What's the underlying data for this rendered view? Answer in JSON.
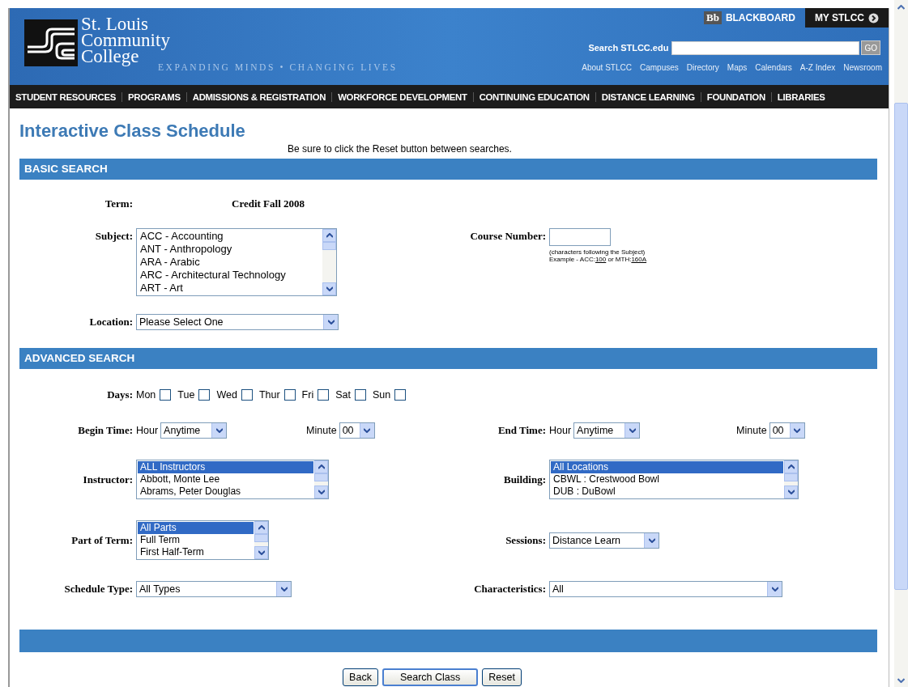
{
  "header": {
    "logo_lines": [
      "St. Louis",
      "Community",
      "College"
    ],
    "tagline": "EXPANDING MINDS • CHANGING LIVES",
    "top_links": [
      {
        "badge": "Bb",
        "label": "BLACKBOARD",
        "kind": "plain"
      },
      {
        "label": "MY STLCC",
        "kind": "dark"
      }
    ],
    "search": {
      "label": "Search STLCC.edu",
      "button": "GO"
    },
    "util_links": [
      "About STLCC",
      "Campuses",
      "Directory",
      "Maps",
      "Calendars",
      "A-Z Index",
      "Newsroom"
    ]
  },
  "nav": [
    "STUDENT RESOURCES",
    "PROGRAMS",
    "ADMISSIONS & REGISTRATION",
    "WORKFORCE DEVELOPMENT",
    "CONTINUING EDUCATION",
    "DISTANCE LEARNING",
    "FOUNDATION",
    "LIBRARIES"
  ],
  "page_title": "Interactive Class Schedule",
  "notice": "Be sure to click the Reset button between searches.",
  "basic": {
    "heading": "BASIC SEARCH",
    "term": {
      "label": "Term:",
      "value": "Credit Fall 2008"
    },
    "subject": {
      "label": "Subject:",
      "options": [
        {
          "text": "ACC - Accounting",
          "selected": false
        },
        {
          "text": "ANT - Anthropology",
          "selected": false
        },
        {
          "text": "ARA - Arabic",
          "selected": false
        },
        {
          "text": "ARC - Architectural Technology",
          "selected": false
        },
        {
          "text": "ART - Art",
          "selected": false
        }
      ]
    },
    "course_number": {
      "label": "Course Number:",
      "hint": "(characters following the Subject)",
      "example": "Example - ACC:",
      "ex1": "100",
      "mid": " or MTH:",
      "ex2": "160A"
    },
    "location": {
      "label": "Location:",
      "value": "Please Select One"
    }
  },
  "advanced": {
    "heading": "ADVANCED SEARCH",
    "days": {
      "label": "Days:",
      "items": [
        {
          "label": "Mon",
          "checked": false
        },
        {
          "label": "Tue",
          "checked": false
        },
        {
          "label": "Wed",
          "checked": false
        },
        {
          "label": "Thur",
          "checked": false
        },
        {
          "label": "Fri",
          "checked": false
        },
        {
          "label": "Sat",
          "checked": false
        },
        {
          "label": "Sun",
          "checked": false
        }
      ]
    },
    "begin_time": {
      "label": "Begin Time:",
      "hour_label": "Hour",
      "hour": "Anytime",
      "minute_label": "Minute",
      "minute": "00"
    },
    "end_time": {
      "label": "End Time:",
      "hour_label": "Hour",
      "hour": "Anytime",
      "minute_label": "Minute",
      "minute": "00"
    },
    "instructor": {
      "label": "Instructor:",
      "options": [
        {
          "text": "ALL Instructors",
          "selected": true
        },
        {
          "text": "Abbott, Monte Lee",
          "selected": false
        },
        {
          "text": "Abrams, Peter Douglas",
          "selected": false
        }
      ]
    },
    "building": {
      "label": "Building:",
      "options": [
        {
          "text": "All Locations",
          "selected": true
        },
        {
          "text": "CBWL : Crestwood Bowl",
          "selected": false
        },
        {
          "text": "DUB : DuBowl",
          "selected": false
        }
      ]
    },
    "part_of_term": {
      "label": "Part of Term:",
      "options": [
        {
          "text": "All Parts",
          "selected": true
        },
        {
          "text": "Full Term",
          "selected": false
        },
        {
          "text": "First Half-Term",
          "selected": false
        }
      ]
    },
    "sessions": {
      "label": "Sessions:",
      "value": "Distance Learn"
    },
    "schedule_type": {
      "label": "Schedule Type:",
      "value": "All Types"
    },
    "characteristics": {
      "label": "Characteristics:",
      "value": "All"
    }
  },
  "buttons": [
    {
      "label": "Back",
      "primary": false
    },
    {
      "label": "Search Class",
      "primary": true
    },
    {
      "label": "Reset",
      "primary": false
    }
  ]
}
